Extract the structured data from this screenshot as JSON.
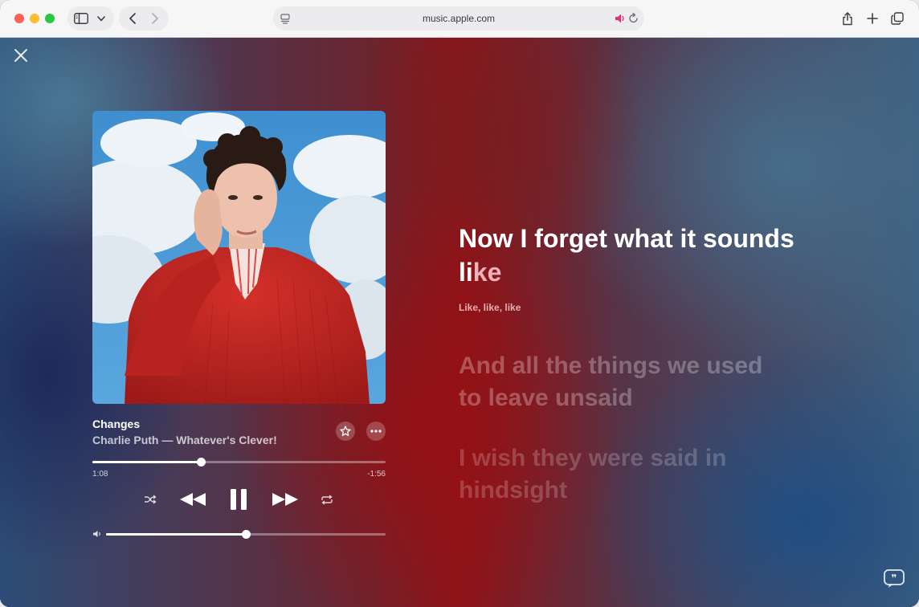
{
  "browser": {
    "url": "music.apple.com"
  },
  "track": {
    "title": "Changes",
    "subtitle": "Charlie Puth — Whatever's Clever!",
    "elapsed": "1:08",
    "remaining": "-1:56",
    "progress": 0.37,
    "volume": 0.5
  },
  "lyrics": {
    "current_line_part1": "Now I forget what it sounds",
    "current_line_part2_sung": "li",
    "current_line_part2_unsung": "ke",
    "background_vocals": "Like, like, like",
    "next_line_1a": "And all the things we used",
    "next_line_1b": "to leave unsaid",
    "next_line_2a": "I wish they were said in",
    "next_line_2b": "hindsight"
  },
  "colors": {
    "accent_red": "#8c1418",
    "volume_icon_pink": "#e0336e"
  }
}
